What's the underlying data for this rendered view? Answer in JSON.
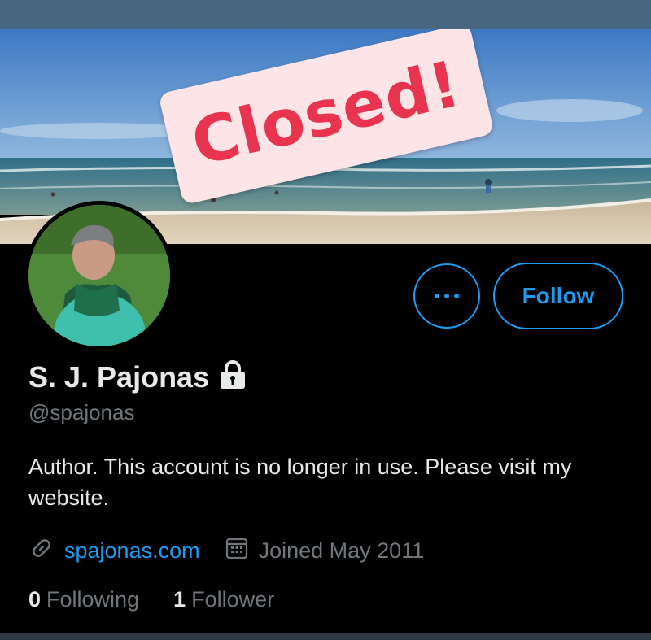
{
  "banner": {
    "sticker_text": "Closed!"
  },
  "profile": {
    "display_name": "S. J. Pajonas",
    "handle": "@spajonas",
    "bio": "Author. This account is no longer in use. Please visit my website.",
    "website": "spajonas.com",
    "joined": "Joined May 2011",
    "following_count": "0",
    "following_label": "Following",
    "followers_count": "1",
    "followers_label": "Follower"
  },
  "actions": {
    "follow_label": "Follow"
  },
  "icons": {
    "more": "more-options-icon",
    "lock": "lock-icon",
    "link": "link-icon",
    "calendar": "calendar-icon"
  },
  "colors": {
    "accent": "#1d9bf0",
    "background": "#000000",
    "sticker_text": "#e8344e",
    "sticker_bg": "#fde4e6"
  }
}
